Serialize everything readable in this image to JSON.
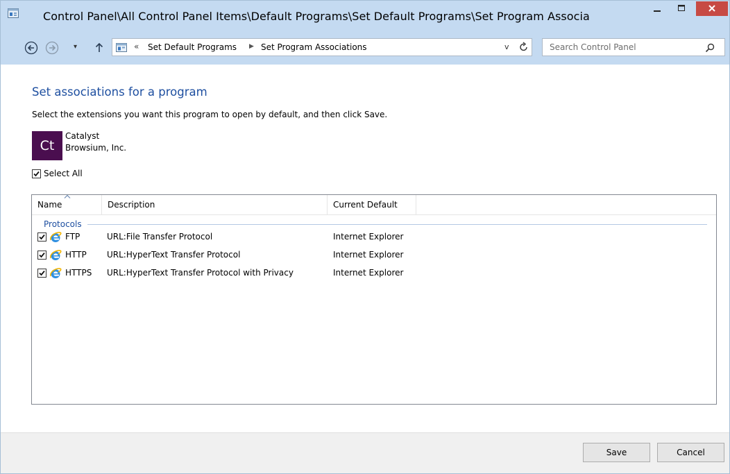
{
  "window": {
    "title": "Control Panel\\All Control Panel Items\\Default Programs\\Set Default Programs\\Set Program Associa",
    "close_label": "✕"
  },
  "nav": {
    "back_icon": "back-arrow-icon",
    "forward_icon": "forward-arrow-icon",
    "recent_dropdown": "▾",
    "up_icon": "up-arrow-icon",
    "address_overflow": "«",
    "breadcrumb": [
      "Set Default Programs",
      "Set Program Associations"
    ],
    "breadcrumb_separator": "▶",
    "address_dropdown": "v",
    "search_placeholder": "Search Control Panel"
  },
  "page": {
    "heading": "Set associations for a program",
    "instructions": "Select the extensions you want this program to open by default, and then click Save.",
    "program": {
      "icon_text": "Ct",
      "icon_color": "#4a0e4f",
      "name": "Catalyst",
      "company": "Browsium, Inc."
    },
    "select_all": {
      "label": "Select All",
      "checked": true
    }
  },
  "list": {
    "columns": [
      "Name",
      "Description",
      "Current Default"
    ],
    "sort_column": "Name",
    "group": "Protocols",
    "rows": [
      {
        "name": "FTP",
        "description": "URL:File Transfer Protocol",
        "current_default": "Internet Explorer",
        "checked": true
      },
      {
        "name": "HTTP",
        "description": "URL:HyperText Transfer Protocol",
        "current_default": "Internet Explorer",
        "checked": true
      },
      {
        "name": "HTTPS",
        "description": "URL:HyperText Transfer Protocol with Privacy",
        "current_default": "Internet Explorer",
        "checked": true
      }
    ]
  },
  "footer": {
    "save_label": "Save",
    "cancel_label": "Cancel"
  },
  "colors": {
    "titlebar": "#c4daf1",
    "heading": "#1e4fa0",
    "close_button": "#c74a44"
  }
}
